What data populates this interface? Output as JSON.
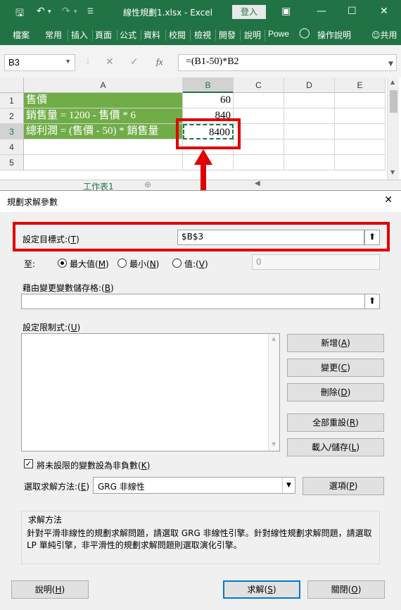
{
  "window": {
    "title": "線性規劃1.xlsx  -  Excel",
    "signin_label": "登入"
  },
  "ribbon": {
    "tabs": [
      "檔案",
      "常用",
      "插入",
      "頁面",
      "公式",
      "資料",
      "校閱",
      "檢視",
      "開發",
      "說明",
      "Powe"
    ],
    "tell_me": "操作說明",
    "share": "共用"
  },
  "formula_bar": {
    "name_box": "B3",
    "formula": "=(B1-50)*B2",
    "fx": "fx"
  },
  "sheet": {
    "columns": [
      "A",
      "B",
      "C",
      "D",
      "E"
    ],
    "rows": [
      "1",
      "2",
      "3",
      "4",
      "5"
    ],
    "cells": {
      "A1": "售價",
      "A2": "銷售量 = 1200 - 售價 * 6",
      "A3": "總利潤 = (售價 - 50) * 銷售量",
      "B1": "60",
      "B2": "840",
      "B3": "8400"
    },
    "sheet_tab": "工作表1"
  },
  "solver": {
    "title": "規劃求解參數",
    "objective_label": "設定目標式:(",
    "objective_key": "T",
    "objective_value": "$B$3",
    "to_label": "至:",
    "options": [
      {
        "label": "最大值(",
        "key": "M",
        "checked": true
      },
      {
        "label": "最小(",
        "key": "N",
        "checked": false
      },
      {
        "label": "值:(",
        "key": "V",
        "checked": false
      }
    ],
    "value_field": "0",
    "variables_label": "藉由變更變數儲存格:(",
    "variables_key": "B",
    "variables_value": "",
    "constraints_label": "設定限制式:(",
    "constraints_key": "U",
    "buttons": {
      "add": "新增(",
      "add_key": "A",
      "change": "變更(",
      "change_key": "C",
      "delete": "刪除(",
      "delete_key": "D",
      "reset": "全部重設(",
      "reset_key": "R",
      "load_save": "載入/儲存(",
      "load_save_key": "L",
      "options": "選項(",
      "options_key": "P",
      "help": "說明(",
      "help_key": "H",
      "solve": "求解(",
      "solve_key": "S",
      "close": "關閉(",
      "close_key": "O"
    },
    "nonneg_label": "將未設限的變數設為非負數(",
    "nonneg_key": "K",
    "nonneg_checked": true,
    "method_label": "選取求解方法:(",
    "method_key": "E",
    "method_value": "GRG 非線性",
    "desc_title": "求解方法",
    "desc_text": "針對平滑非線性的規劃求解問題，請選取 GRG 非線性引擎。針對線性規劃求解問題，請選取 LP 單純引擎，非平滑性的規劃求解問題則選取演化引擎。"
  },
  "colors": {
    "excel_green": "#217346",
    "cell_green": "#70ad47",
    "highlight_red": "#e00000"
  }
}
